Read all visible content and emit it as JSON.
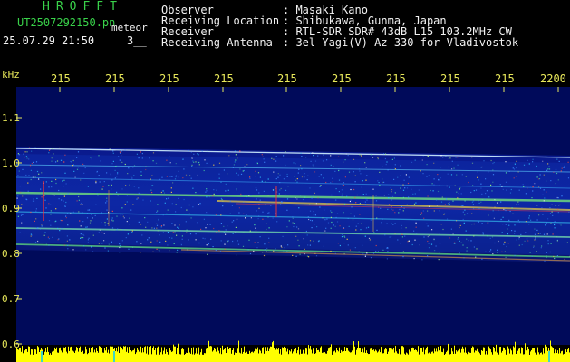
{
  "header": {
    "app_title": "HROFFT",
    "filename": "UT2507292150.pn",
    "filename_suffix": "meteor",
    "datetime": "25.07.29 21:50",
    "mode": "3__"
  },
  "metadata": [
    {
      "key": "Observer",
      "value": ": Masaki Kano"
    },
    {
      "key": "Receiving Location",
      "value": ": Shibukawa, Gunma, Japan"
    },
    {
      "key": "Receiver",
      "value": ": RTL-SDR SDR# 43dB L15 103.2MHz CW"
    },
    {
      "key": "Receiving Antenna",
      "value": ": 3el Yagi(V) Az 330 for Vladivostok"
    }
  ],
  "y_axis": {
    "unit": "kHz",
    "ticks": [
      "1.1",
      "1.0",
      "0.9",
      "0.8",
      "0.7",
      "0.6"
    ]
  },
  "x_axis": {
    "ticks": [
      "215",
      "215",
      "215",
      "215",
      "215",
      "215",
      "215",
      "215",
      "215",
      "2200"
    ]
  },
  "colors": {
    "background": "#000000",
    "plot_background": "#000a5a",
    "header_title": "#39d24a",
    "label_text": "#f2f2f2",
    "axis_text": "#e8e85a",
    "signal_bar": "#ffff00"
  }
}
